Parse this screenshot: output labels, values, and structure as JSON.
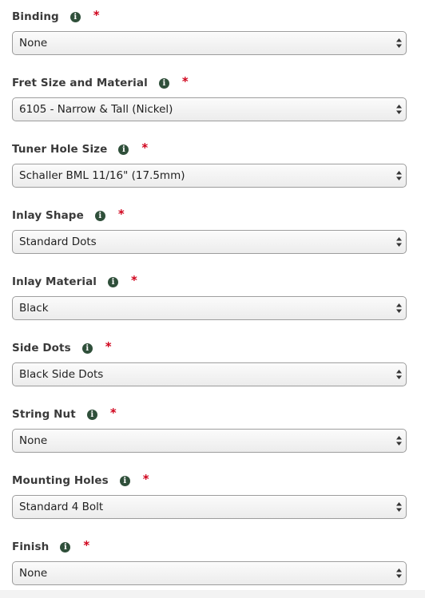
{
  "required_symbol": "*",
  "info_icon_glyph": "i",
  "colors": {
    "required": "#d0021b",
    "info_icon": "#2f4f3a",
    "label_text": "#3a3a3a"
  },
  "fields": [
    {
      "label": "Binding",
      "value": "None"
    },
    {
      "label": "Fret Size and Material",
      "value": "6105 - Narrow & Tall (Nickel)"
    },
    {
      "label": "Tuner Hole Size",
      "value": "Schaller BML 11/16\" (17.5mm)"
    },
    {
      "label": "Inlay Shape",
      "value": "Standard Dots"
    },
    {
      "label": "Inlay Material",
      "value": "Black"
    },
    {
      "label": "Side Dots",
      "value": "Black Side Dots"
    },
    {
      "label": "String Nut",
      "value": "None"
    },
    {
      "label": "Mounting Holes",
      "value": "Standard 4 Bolt"
    },
    {
      "label": "Finish",
      "value": "None"
    }
  ]
}
